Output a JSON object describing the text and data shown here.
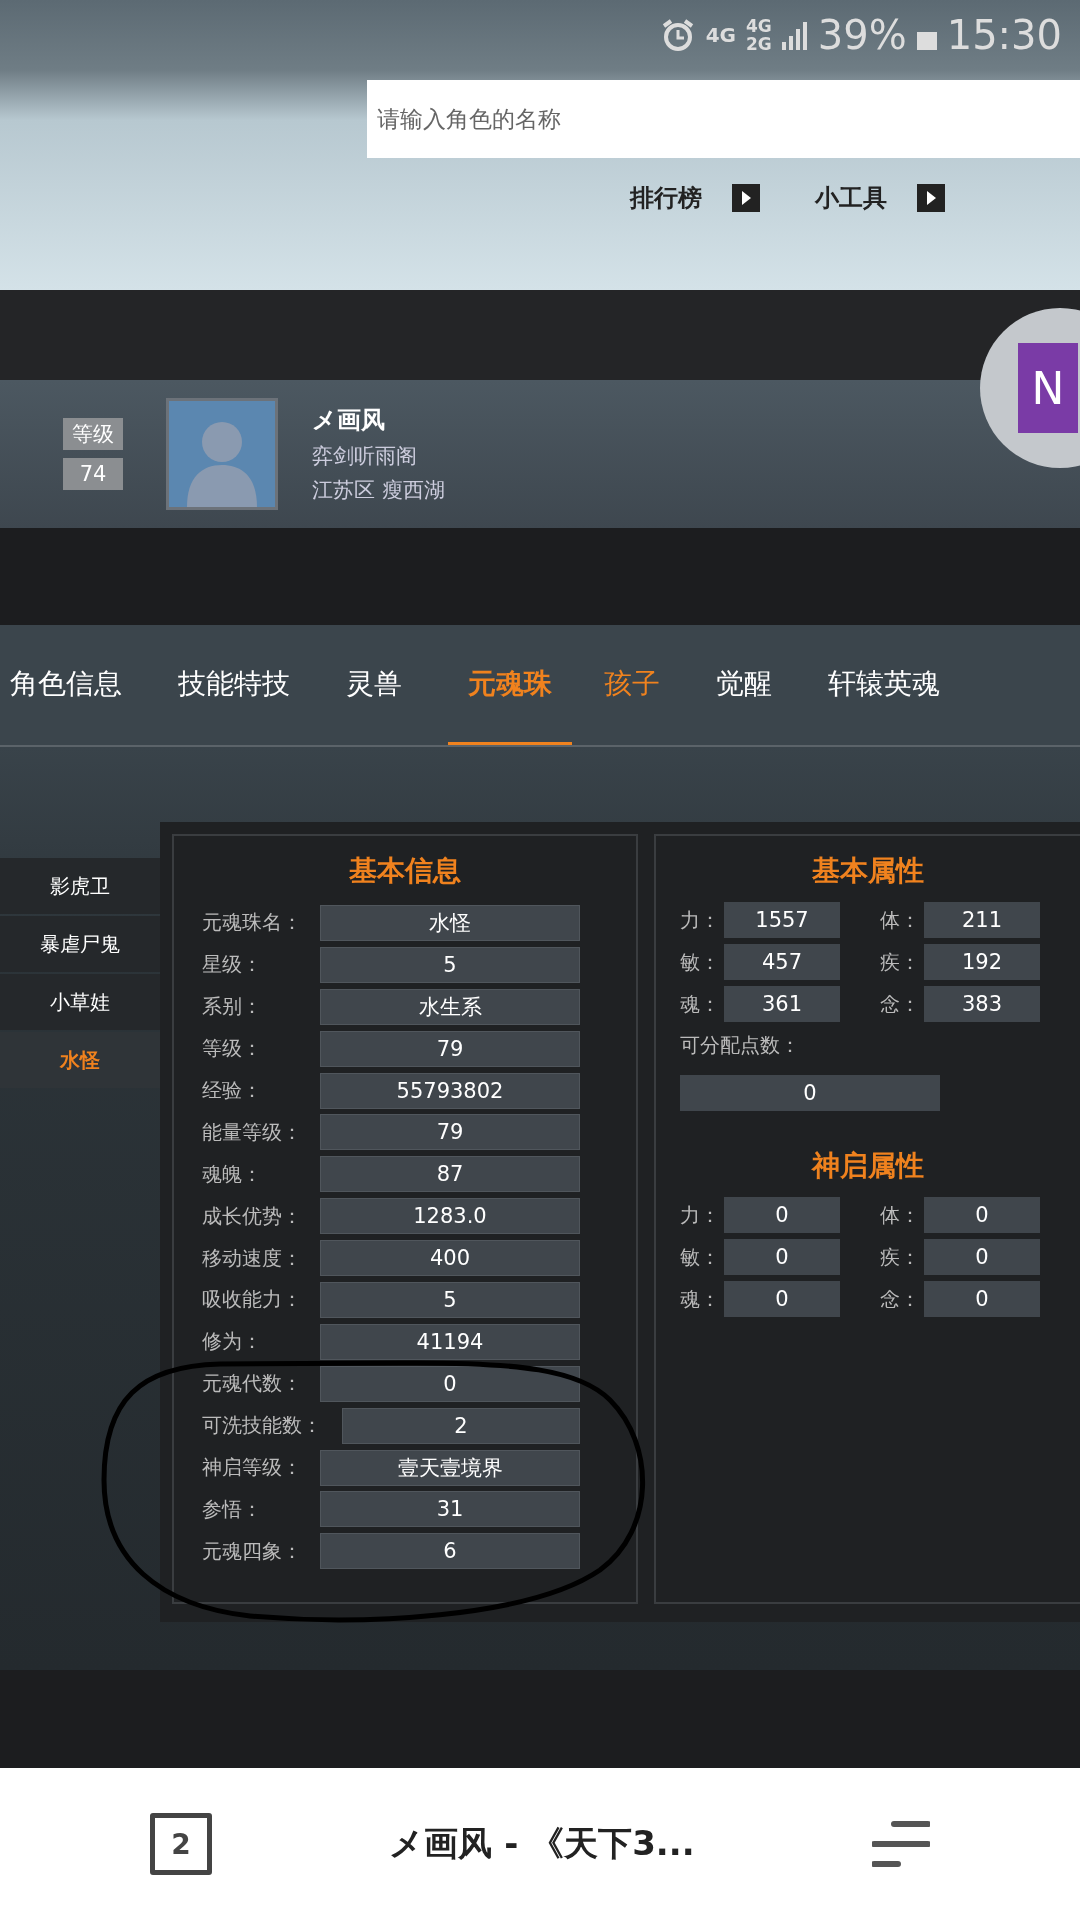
{
  "status_bar": {
    "network_1": "4G",
    "network_2": "4G",
    "network_3": "2G",
    "battery": "39%",
    "time": "15:30"
  },
  "search": {
    "placeholder": "请输入角色的名称"
  },
  "header_links": [
    "排行榜",
    "小工具"
  ],
  "profile": {
    "level_label": "等级",
    "level": "74",
    "name": "メ画风",
    "guild": "弈剑听雨阁",
    "server": "江苏区 瘦西湖"
  },
  "floating_button": {
    "letter": "N"
  },
  "tabs": [
    {
      "label": "角色信息",
      "selected": false,
      "highlighted": false
    },
    {
      "label": "技能特技",
      "selected": false,
      "highlighted": false
    },
    {
      "label": "灵兽",
      "selected": false,
      "highlighted": false
    },
    {
      "label": "元魂珠",
      "selected": true,
      "highlighted": true
    },
    {
      "label": "孩子",
      "selected": false,
      "highlighted": true
    },
    {
      "label": "觉醒",
      "selected": false,
      "highlighted": false
    },
    {
      "label": "轩辕英魂",
      "selected": false,
      "highlighted": false
    }
  ],
  "side_list": [
    {
      "label": "影虎卫",
      "selected": false
    },
    {
      "label": "暴虐尸鬼",
      "selected": false
    },
    {
      "label": "小草娃",
      "selected": false
    },
    {
      "label": "水怪",
      "selected": true
    }
  ],
  "basic_info": {
    "title": "基本信息",
    "rows": [
      {
        "label": "元魂珠名：",
        "value": "水怪"
      },
      {
        "label": "星级：",
        "value": "5"
      },
      {
        "label": "系别：",
        "value": "水生系"
      },
      {
        "label": "等级：",
        "value": "79"
      },
      {
        "label": "经验：",
        "value": "55793802"
      },
      {
        "label": "能量等级：",
        "value": "79"
      },
      {
        "label": "魂魄：",
        "value": "87"
      },
      {
        "label": "成长优势：",
        "value": "1283.0"
      },
      {
        "label": "移动速度：",
        "value": "400"
      },
      {
        "label": "吸收能力：",
        "value": "5"
      },
      {
        "label": "修为：",
        "value": "41194"
      },
      {
        "label": "元魂代数：",
        "value": "0"
      },
      {
        "label": "可洗技能数：",
        "value": "2"
      },
      {
        "label": "神启等级：",
        "value": "壹天壹境界"
      },
      {
        "label": "参悟：",
        "value": "31"
      },
      {
        "label": "元魂四象：",
        "value": "6"
      }
    ]
  },
  "basic_attributes": {
    "title": "基本属性",
    "stats": [
      {
        "label": "力：",
        "value": "1557"
      },
      {
        "label": "体：",
        "value": "211"
      },
      {
        "label": "敏：",
        "value": "457"
      },
      {
        "label": "疾：",
        "value": "192"
      },
      {
        "label": "魂：",
        "value": "361"
      },
      {
        "label": "念：",
        "value": "383"
      }
    ],
    "free_points_label": "可分配点数：",
    "free_points": "0"
  },
  "divine_attributes": {
    "title": "神启属性",
    "stats": [
      {
        "label": "力：",
        "value": "0"
      },
      {
        "label": "体：",
        "value": "0"
      },
      {
        "label": "敏：",
        "value": "0"
      },
      {
        "label": "疾：",
        "value": "0"
      },
      {
        "label": "魂：",
        "value": "0"
      },
      {
        "label": "念：",
        "value": "0"
      }
    ]
  },
  "browser_bar": {
    "tab_count": "2",
    "page_title": "メ画风 - 《天下3..."
  }
}
